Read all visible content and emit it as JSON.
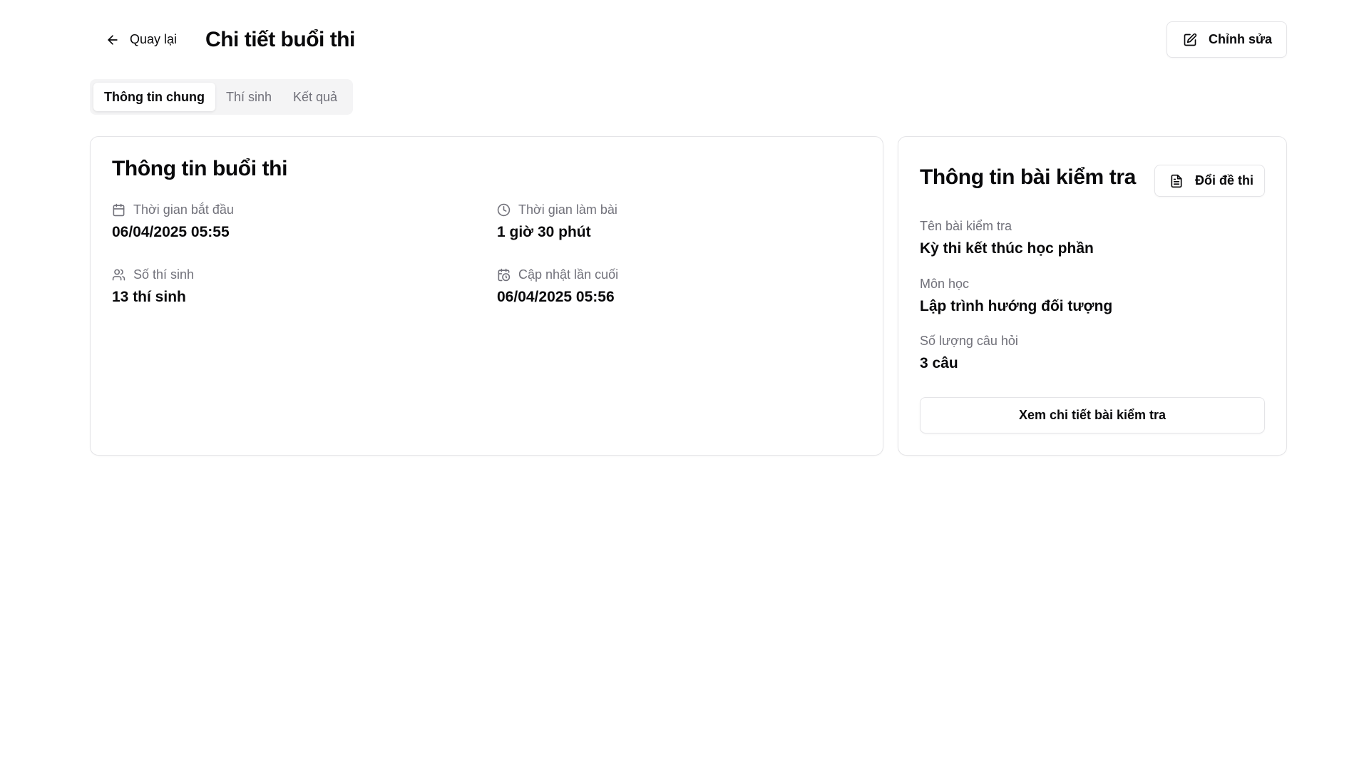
{
  "header": {
    "back_label": "Quay lại",
    "title": "Chi tiết buổi thi",
    "edit_label": "Chỉnh sửa"
  },
  "tabs": [
    {
      "label": "Thông tin chung",
      "active": true
    },
    {
      "label": "Thí sinh",
      "active": false
    },
    {
      "label": "Kết quả",
      "active": false
    }
  ],
  "session": {
    "title": "Thông tin buổi thi",
    "start_time": {
      "label": "Thời gian bắt đầu",
      "value": "06/04/2025 05:55",
      "icon": "calendar-icon"
    },
    "duration": {
      "label": "Thời gian làm bài",
      "value": "1 giờ 30 phút",
      "icon": "clock-icon"
    },
    "candidates": {
      "label": "Số thí sinh",
      "value": "13 thí sinh",
      "icon": "users-icon"
    },
    "last_updated": {
      "label": "Cập nhật lần cuối",
      "value": "06/04/2025 05:56",
      "icon": "calendar-clock-icon"
    }
  },
  "test": {
    "title": "Thông tin bài kiểm tra",
    "swap_label": "Đổi đề thi",
    "name_label": "Tên bài kiểm tra",
    "name_value": "Kỳ thi kết thúc học phần",
    "subject_label": "Môn học",
    "subject_value": "Lập trình hướng đối tượng",
    "questions_label": "Số lượng câu hỏi",
    "questions_value": "3 câu",
    "detail_button": "Xem chi tiết bài kiểm tra"
  },
  "colors": {
    "text": "#09090b",
    "muted": "#71717a",
    "border": "#e4e4e7",
    "tab_bg": "#f4f4f5"
  }
}
